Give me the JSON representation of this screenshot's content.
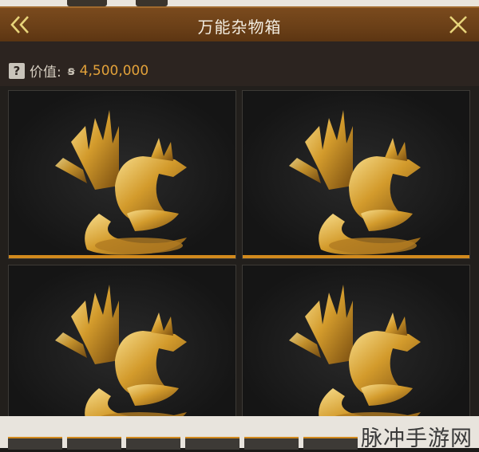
{
  "window": {
    "title": "万能杂物箱"
  },
  "value": {
    "label": "价值:",
    "amount": "4,500,000",
    "currency_icon": "coin-icon"
  },
  "slots": [
    {
      "item": "golden-dragon-statue"
    },
    {
      "item": "golden-dragon-statue"
    },
    {
      "item": "golden-dragon-statue"
    },
    {
      "item": "golden-dragon-statue"
    }
  ],
  "watermark": "脉冲手游网",
  "colors": {
    "title_bar": "#6a3f17",
    "accent": "#d28a1d",
    "value_text": "#e3a23a"
  }
}
